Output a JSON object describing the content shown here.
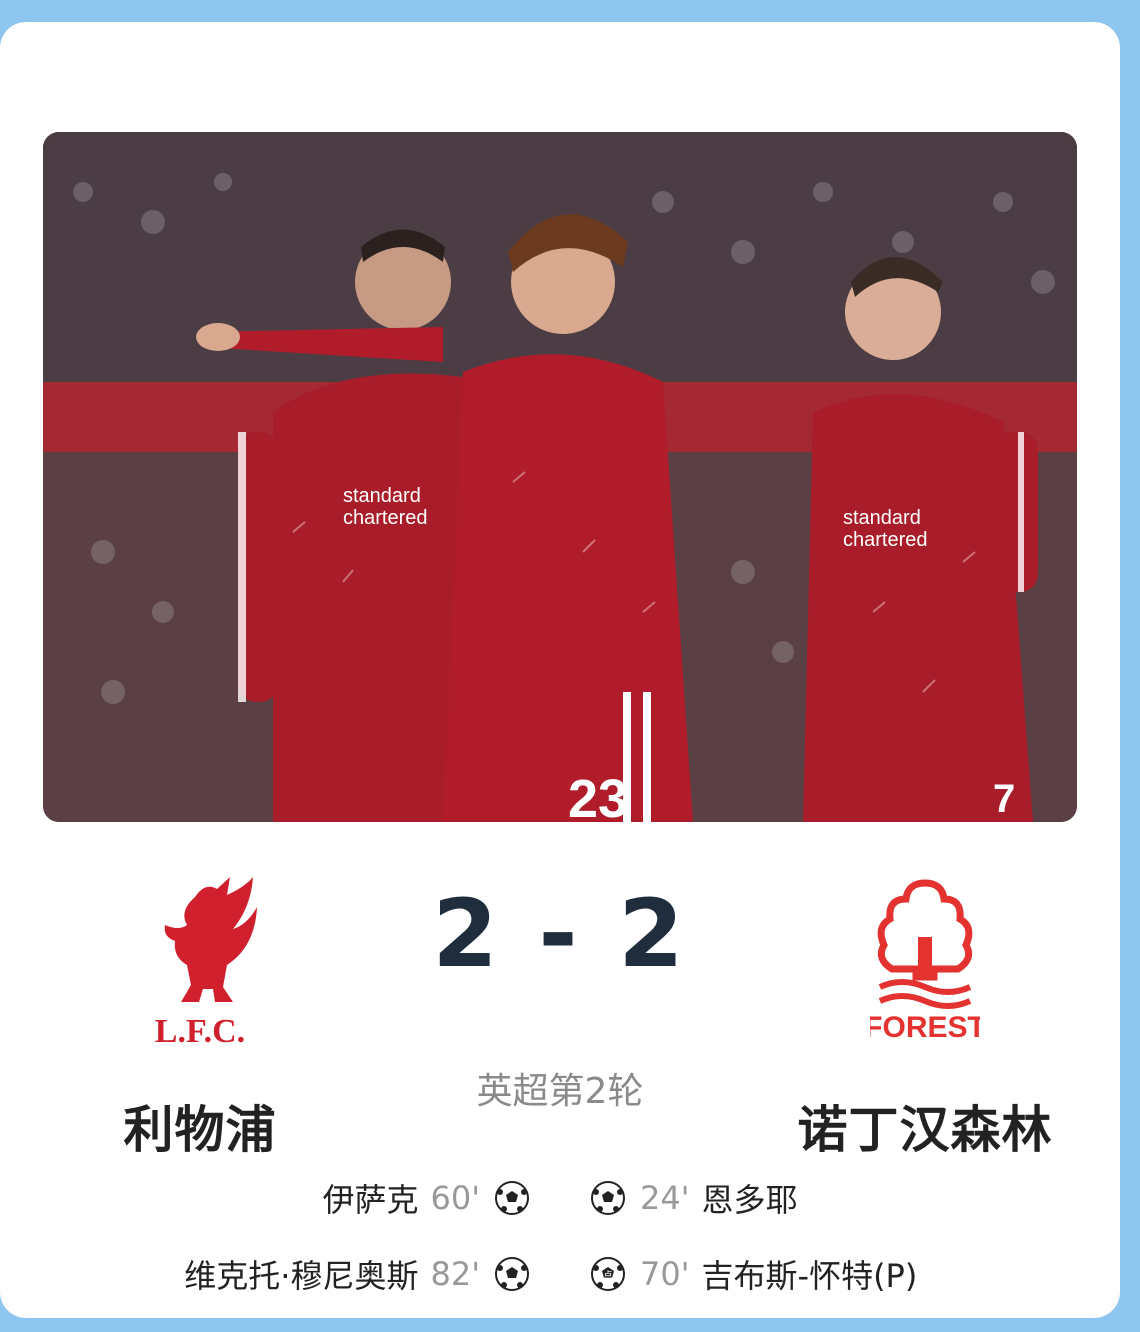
{
  "match": {
    "home": {
      "name": "利物浦",
      "crest_text": "L.F.C.",
      "crest_color": "#d0202e"
    },
    "away": {
      "name": "诺丁汉森林",
      "crest_text": "FOREST",
      "crest_color": "#e3322f"
    },
    "score": "2 - 2",
    "round": "英超第2轮"
  },
  "goals": {
    "home": [
      {
        "player": "伊萨克",
        "minute": "60'",
        "icon": "soccer-ball-icon"
      },
      {
        "player": "维克托·穆尼奥斯",
        "minute": "82'",
        "icon": "soccer-ball-icon"
      }
    ],
    "away": [
      {
        "player": "恩多耶",
        "minute": "24'",
        "icon": "soccer-ball-icon"
      },
      {
        "player": "吉布斯-怀特(P)",
        "minute": "70'",
        "icon": "penalty-ball-icon"
      }
    ]
  },
  "photo": {
    "jersey_numbers": [
      "23",
      "7"
    ],
    "sponsor": "standard chartered",
    "colors": {
      "kit": "#b01c2a",
      "trim": "#ffffff"
    }
  }
}
